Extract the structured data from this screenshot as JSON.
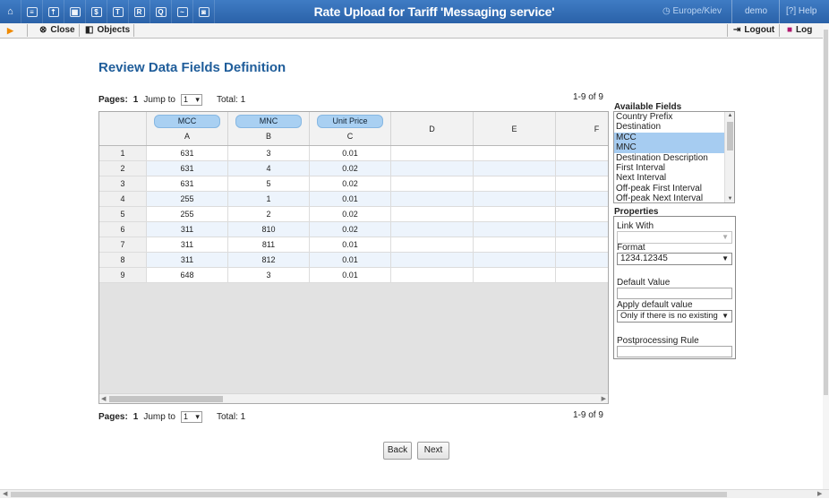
{
  "header": {
    "title": "Rate Upload for Tariff 'Messaging service'",
    "timezone": "Europe/Kiev",
    "user": "demo",
    "help": "Help",
    "icons": [
      "home-icon",
      "list-icon",
      "upload-icon",
      "grid-icon",
      "rates-icon",
      "tariff-icon",
      "table-icon",
      "search-icon",
      "chart-icon",
      "camera-icon"
    ],
    "icon_glyphs": [
      "⌂",
      "≡",
      "⇡",
      "▦",
      "$",
      "T",
      "R",
      "Q",
      "~",
      "◙"
    ]
  },
  "toolbar": {
    "close": "Close",
    "objects": "Objects",
    "logout": "Logout",
    "log": "Log"
  },
  "page": {
    "heading": "Review Data Fields Definition",
    "pager_top": {
      "pages_label": "Pages:",
      "page": "1",
      "jump_label": "Jump to",
      "jump_value": "1",
      "total": "Total: 1",
      "range": "1-9 of 9"
    },
    "pager_bottom": {
      "pages_label": "Pages:",
      "page": "1",
      "jump_label": "Jump to",
      "jump_value": "1",
      "total": "Total: 1",
      "range": "1-9 of 9"
    }
  },
  "grid": {
    "columns": [
      {
        "field": "MCC",
        "letter": "A"
      },
      {
        "field": "MNC",
        "letter": "B"
      },
      {
        "field": "Unit Price",
        "letter": "C"
      },
      {
        "field": "",
        "letter": "D"
      },
      {
        "field": "",
        "letter": "E"
      },
      {
        "field": "",
        "letter": "F"
      }
    ],
    "rows": [
      {
        "n": "1",
        "a": "631",
        "b": "3",
        "c": "0.01"
      },
      {
        "n": "2",
        "a": "631",
        "b": "4",
        "c": "0.02"
      },
      {
        "n": "3",
        "a": "631",
        "b": "5",
        "c": "0.02"
      },
      {
        "n": "4",
        "a": "255",
        "b": "1",
        "c": "0.01"
      },
      {
        "n": "5",
        "a": "255",
        "b": "2",
        "c": "0.02"
      },
      {
        "n": "6",
        "a": "311",
        "b": "810",
        "c": "0.02"
      },
      {
        "n": "7",
        "a": "311",
        "b": "811",
        "c": "0.01"
      },
      {
        "n": "8",
        "a": "311",
        "b": "812",
        "c": "0.01"
      },
      {
        "n": "9",
        "a": "648",
        "b": "3",
        "c": "0.01"
      }
    ]
  },
  "available_fields": {
    "title": "Available Fields",
    "items": [
      {
        "label": "Country Prefix",
        "selected": false
      },
      {
        "label": "Destination",
        "selected": false
      },
      {
        "label": "MCC",
        "selected": true
      },
      {
        "label": "MNC",
        "selected": true
      },
      {
        "label": "Destination Description",
        "selected": false
      },
      {
        "label": "First Interval",
        "selected": false
      },
      {
        "label": "Next Interval",
        "selected": false
      },
      {
        "label": "Off-peak First Interval",
        "selected": false
      },
      {
        "label": "Off-peak Next Interval",
        "selected": false
      }
    ]
  },
  "properties": {
    "title": "Properties",
    "link_with_label": "Link With",
    "link_with_value": "",
    "format_label": "Format",
    "format_value": "1234.12345",
    "default_value_label": "Default Value",
    "default_value": "",
    "apply_default_label": "Apply default value",
    "apply_default_value": "Only if there is no existing",
    "postprocessing_label": "Postprocessing Rule",
    "postprocessing_value": ""
  },
  "buttons": {
    "back": "Back",
    "next": "Next"
  },
  "colors": {
    "header_blue": "#2f6db5",
    "heading_blue": "#1f5d9a",
    "selected_field": "#a6ccf1",
    "column_pill": "#a9d0f2"
  }
}
